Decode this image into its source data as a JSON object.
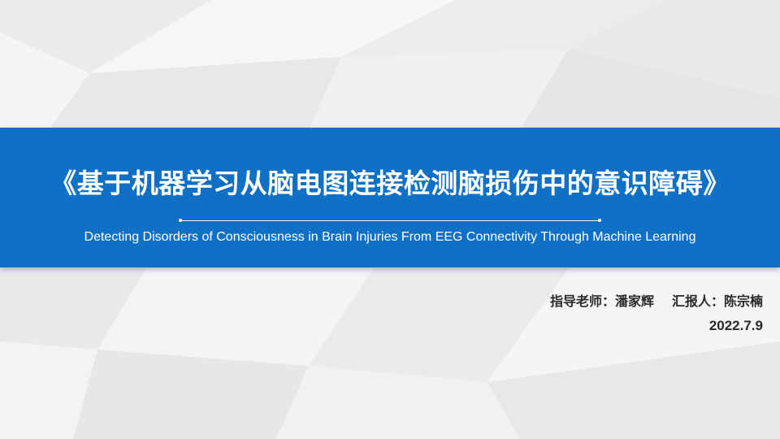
{
  "slide": {
    "title": "《基于机器学习从脑电图连接检测脑损伤中的意识障碍》",
    "subtitle": "Detecting Disorders of Consciousness in Brain Injuries From EEG Connectivity Through Machine Learning",
    "supervisor": "指导老师：潘家辉",
    "presenter": "汇报人：陈宗楠",
    "date": "2022.7.9"
  },
  "colors": {
    "banner": "#0f70c6",
    "background": "#f1f1f1",
    "text_dark": "#2a2a2a",
    "text_light": "#ffffff"
  }
}
